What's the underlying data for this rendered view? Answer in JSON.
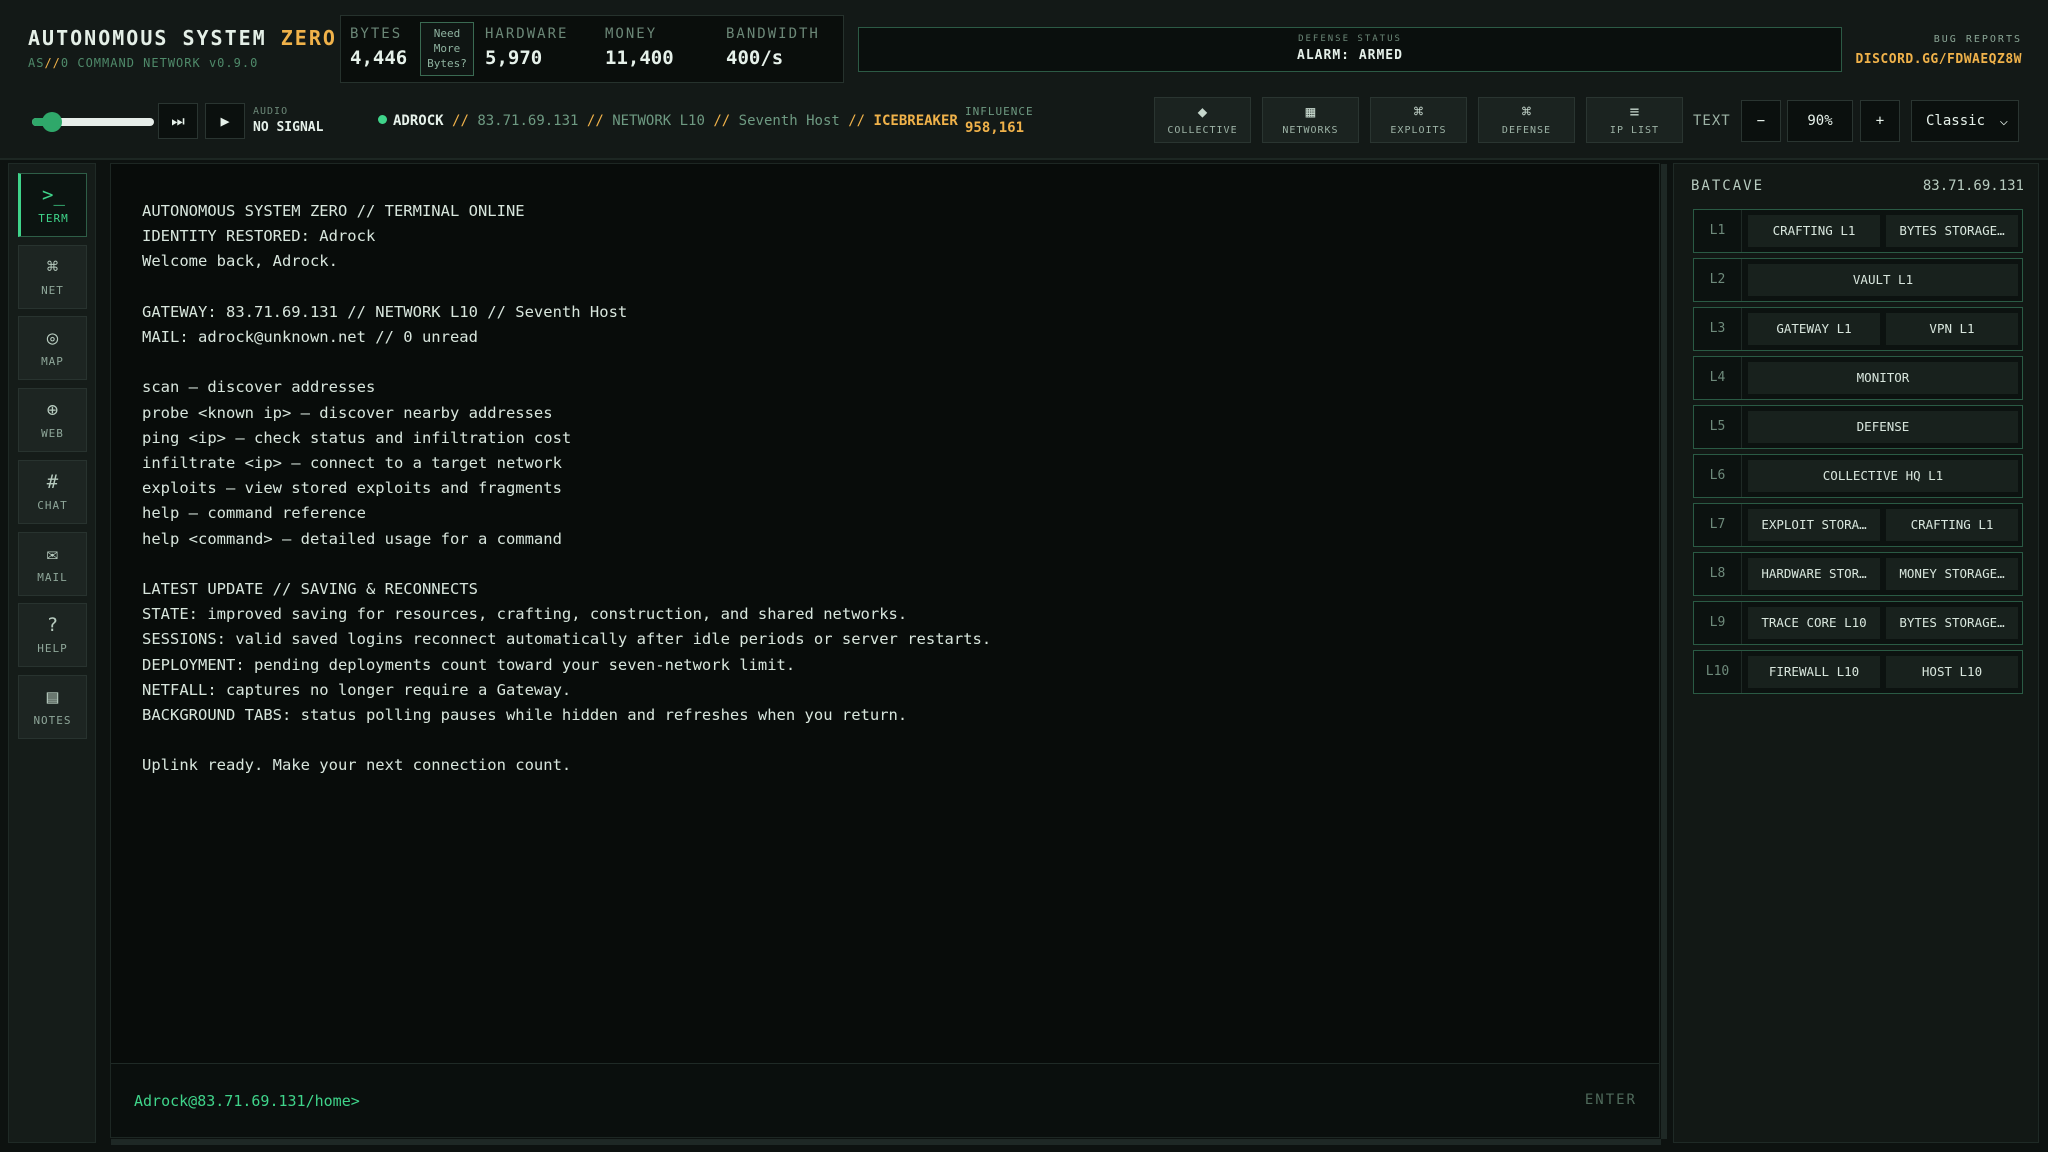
{
  "brand": {
    "title": "AUTONOMOUS SYSTEM",
    "title_accent": "ZERO",
    "sub_pre": "AS",
    "sub_slash": "//",
    "sub_post": "0 COMMAND NETWORK v0.9.0"
  },
  "resources": {
    "bytes_label": "BYTES",
    "bytes_value": "4,446",
    "need_bytes": [
      "Need",
      "More",
      "Bytes?"
    ],
    "hardware_label": "HARDWARE",
    "hardware_value": "5,970",
    "money_label": "MONEY",
    "money_value": "11,400",
    "bandwidth_label": "BANDWIDTH",
    "bandwidth_value": "400/s"
  },
  "defense": {
    "label": "DEFENSE STATUS",
    "value": "ALARM: ARMED"
  },
  "bug_reports": {
    "label": "BUG REPORTS",
    "link": "DISCORD.GG/FDWAEQZ8W"
  },
  "audio": {
    "label": "AUDIO",
    "value": "NO SIGNAL",
    "volume_fraction": 0.08,
    "skip_icon": "⏭",
    "play_icon": "▶"
  },
  "route": {
    "user": "ADROCK",
    "sep": "//",
    "ip": "83.71.69.131",
    "network": "NETWORK L10",
    "host": "Seventh Host",
    "tool": "ICEBREAKER"
  },
  "influence": {
    "label": "INFLUENCE",
    "value": "958,161"
  },
  "nav": [
    {
      "icon": "◆",
      "label": "COLLECTIVE"
    },
    {
      "icon": "▦",
      "label": "NETWORKS"
    },
    {
      "icon": "⌘",
      "label": "EXPLOITS"
    },
    {
      "icon": "⌘",
      "label": "DEFENSE"
    },
    {
      "icon": "≡",
      "label": "IP LIST"
    }
  ],
  "text_controls": {
    "label": "TEXT",
    "minus": "−",
    "zoom": "90%",
    "plus": "+",
    "theme": "Classic",
    "theme_chevron": "⌵"
  },
  "sidebar": [
    {
      "icon": ">_",
      "label": "TERM"
    },
    {
      "icon": "⌘",
      "label": "NET"
    },
    {
      "icon": "◎",
      "label": "MAP"
    },
    {
      "icon": "⊕",
      "label": "WEB"
    },
    {
      "icon": "#",
      "label": "CHAT"
    },
    {
      "icon": "✉",
      "label": "MAIL"
    },
    {
      "icon": "?",
      "label": "HELP"
    },
    {
      "icon": "▤",
      "label": "NOTES"
    }
  ],
  "terminal": {
    "lines": [
      "AUTONOMOUS SYSTEM ZERO // TERMINAL ONLINE",
      "IDENTITY RESTORED: Adrock",
      "Welcome back, Adrock.",
      "",
      "GATEWAY: 83.71.69.131 // NETWORK L10 // Seventh Host",
      "MAIL: adrock@unknown.net // 0 unread",
      "",
      "scan — discover addresses",
      "probe <known ip> — discover nearby addresses",
      "ping <ip> — check status and infiltration cost",
      "infiltrate <ip> — connect to a target network",
      "exploits — view stored exploits and fragments",
      "help — command reference",
      "help <command> — detailed usage for a command",
      "",
      "LATEST UPDATE // SAVING & RECONNECTS",
      "STATE: improved saving for resources, crafting, construction, and shared networks.",
      "SESSIONS: valid saved logins reconnect automatically after idle periods or server restarts.",
      "DEPLOYMENT: pending deployments count toward your seven-network limit.",
      "NETFALL: captures no longer require a Gateway.",
      "BACKGROUND TABS: status polling pauses while hidden and refreshes when you return.",
      "",
      "Uplink ready. Make your next connection count."
    ],
    "prompt": "Adrock@83.71.69.131/home>",
    "enter_label": "ENTER"
  },
  "panel": {
    "title": "BATCAVE",
    "ip": "83.71.69.131",
    "rows": [
      {
        "level": "L1",
        "items": [
          "CRAFTING L1",
          "BYTES STORAGE…"
        ]
      },
      {
        "level": "L2",
        "items": [
          "VAULT L1"
        ]
      },
      {
        "level": "L3",
        "items": [
          "GATEWAY L1",
          "VPN L1"
        ]
      },
      {
        "level": "L4",
        "items": [
          "MONITOR"
        ]
      },
      {
        "level": "L5",
        "items": [
          "DEFENSE"
        ]
      },
      {
        "level": "L6",
        "items": [
          "COLLECTIVE HQ L1"
        ]
      },
      {
        "level": "L7",
        "items": [
          "EXPLOIT STORA…",
          "CRAFTING L1"
        ]
      },
      {
        "level": "L8",
        "items": [
          "HARDWARE STOR…",
          "MONEY STORAGE…"
        ]
      },
      {
        "level": "L9",
        "items": [
          "TRACE CORE L10",
          "BYTES STORAGE…"
        ]
      },
      {
        "level": "L10",
        "items": [
          "FIREWALL L10",
          "HOST L10"
        ]
      }
    ]
  }
}
